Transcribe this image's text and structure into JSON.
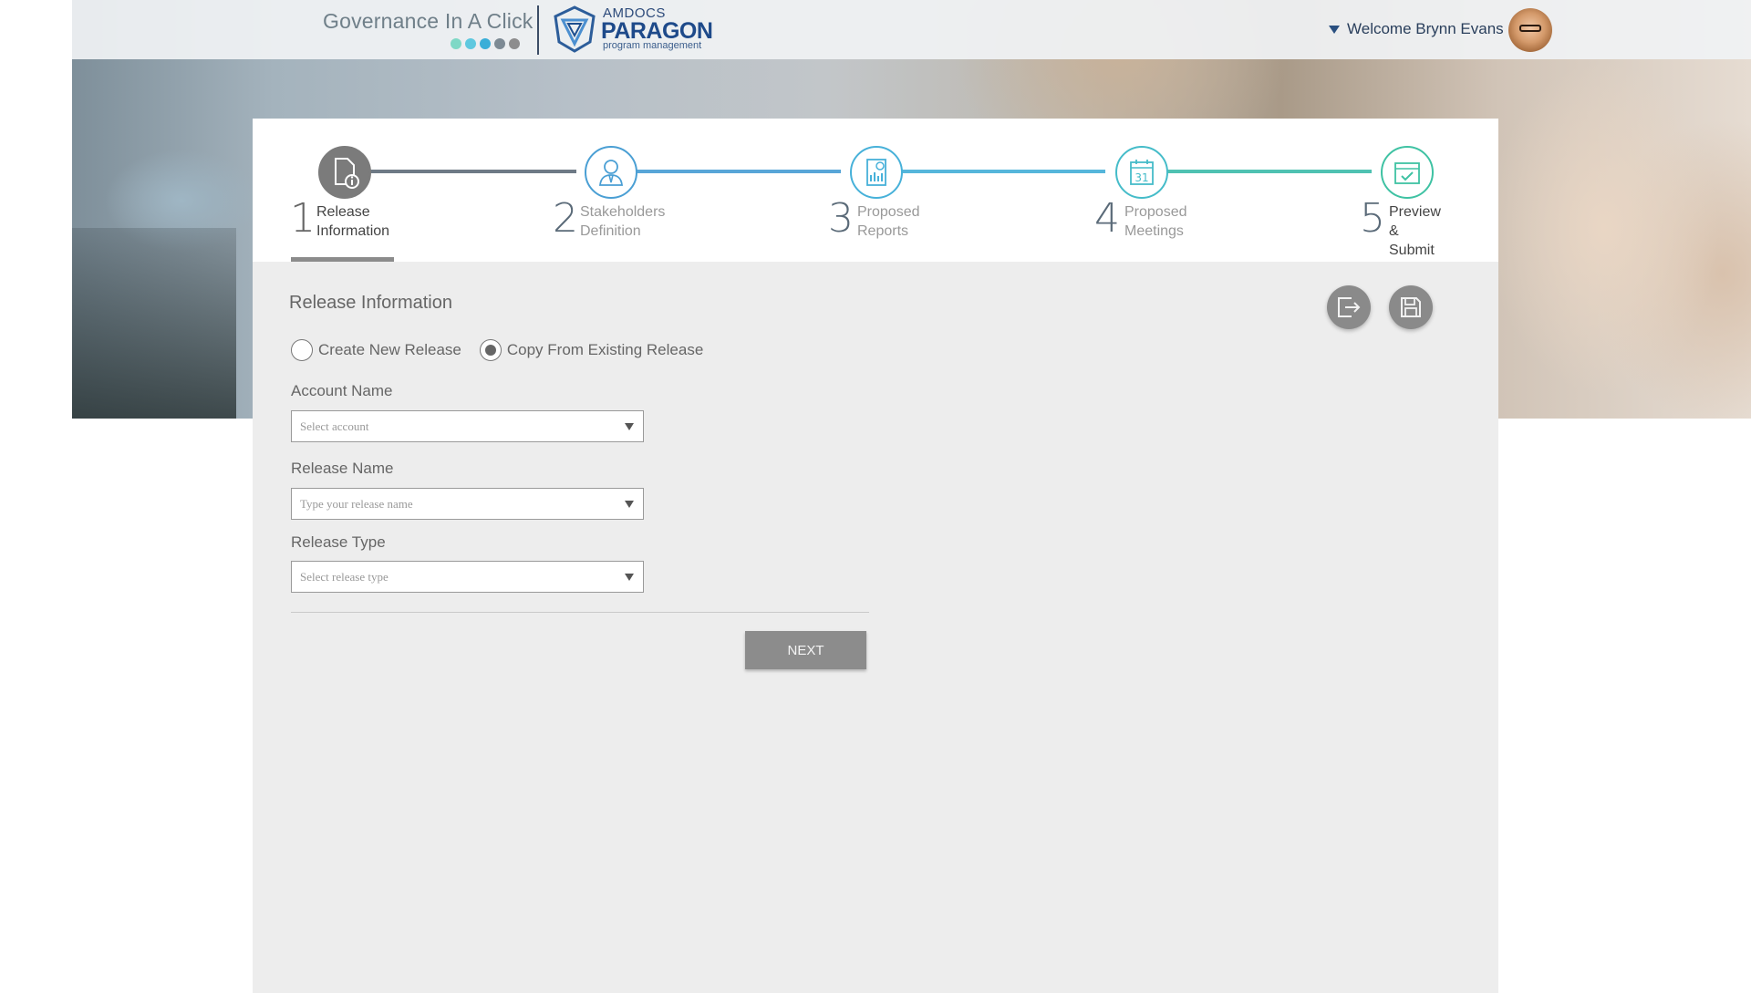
{
  "header": {
    "brand_title": "Governance In A Click",
    "brand_dots": [
      "#7fd8c6",
      "#5ec8df",
      "#3aaed8",
      "#7d8a94",
      "#8d8d8d"
    ],
    "paragon_top": "AMDOCS",
    "paragon_main": "PARAGON",
    "paragon_sub": "program management",
    "welcome_text": "Welcome Brynn Evans"
  },
  "stepper": {
    "steps": [
      {
        "number": "1",
        "label": "Release\nInformation",
        "icon": "document-info-icon",
        "state": "active",
        "color": "#7a7a7a"
      },
      {
        "number": "2",
        "label": "Stakeholders\nDefinition",
        "icon": "stakeholder-icon",
        "state": "pending",
        "color": "#4a9fd4"
      },
      {
        "number": "3",
        "label": "Proposed\nReports",
        "icon": "report-icon",
        "state": "pending",
        "color": "#47b1d9"
      },
      {
        "number": "4",
        "label": "Proposed\nMeetings",
        "icon": "calendar-icon",
        "state": "pending",
        "color": "#45bcc9"
      },
      {
        "number": "5",
        "label": "Preview\n& Submit",
        "icon": "preview-submit-icon",
        "state": "pending",
        "color": "#3fc2a3"
      }
    ],
    "calendar_day": "31"
  },
  "form": {
    "section_title": "Release Information",
    "radio_options": [
      {
        "label": "Create New Release",
        "checked": false
      },
      {
        "label": "Copy From Existing Release",
        "checked": true
      }
    ],
    "account_name_label": "Account Name",
    "account_placeholder": "Select account",
    "release_name_label": "Release Name",
    "release_name_placeholder": "Type your release name",
    "release_type_label": "Release Type",
    "release_type_placeholder": "Select release type",
    "next_label": "NEXT"
  }
}
